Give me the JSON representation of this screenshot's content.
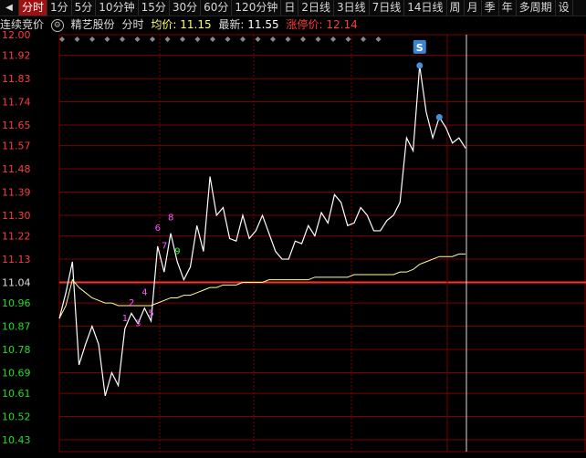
{
  "toolbar": {
    "tabs": [
      {
        "label": "分时",
        "active": true
      },
      {
        "label": "1分"
      },
      {
        "label": "5分"
      },
      {
        "label": "10分钟"
      },
      {
        "label": "15分"
      },
      {
        "label": "30分"
      },
      {
        "label": "60分"
      },
      {
        "label": "120分钟"
      },
      {
        "label": "日"
      },
      {
        "label": "2日线"
      },
      {
        "label": "3日线"
      },
      {
        "label": "7日线"
      },
      {
        "label": "14日线"
      },
      {
        "label": "周"
      },
      {
        "label": "月"
      },
      {
        "label": "季"
      },
      {
        "label": "年"
      },
      {
        "label": "多周期"
      },
      {
        "label": "设"
      }
    ]
  },
  "info": {
    "auction": "连续竞价",
    "stock_name": "精艺股份",
    "mode": "分时",
    "avg_label": "均价:",
    "avg_value": "11.15",
    "latest_label": "最新:",
    "latest_value": "11.55",
    "limit_label": "涨停价:",
    "limit_value": "12.14"
  },
  "marker_s": "S",
  "colors": {
    "up": "#ff3b3b",
    "down": "#22dd22",
    "ref": "#ff3030",
    "price": "#ffffff",
    "avg": "#ffff99",
    "grid": "#7a0000",
    "pink": "#ff55ff"
  },
  "chart_data": {
    "type": "line",
    "y_ticks": [
      "12.00",
      "11.92",
      "11.83",
      "11.74",
      "11.65",
      "11.57",
      "11.48",
      "11.39",
      "11.30",
      "11.22",
      "11.13",
      "11.04",
      "10.96",
      "10.87",
      "10.78",
      "10.69",
      "10.61",
      "10.52",
      "10.43"
    ],
    "ylim": [
      10.43,
      12.0
    ],
    "prev_close": 11.04,
    "price_series": [
      10.9,
      11.0,
      11.12,
      10.72,
      10.8,
      10.87,
      10.8,
      10.6,
      10.69,
      10.64,
      10.86,
      10.92,
      10.88,
      10.94,
      10.89,
      11.18,
      11.08,
      11.23,
      11.12,
      11.05,
      11.1,
      11.26,
      11.16,
      11.45,
      11.3,
      11.33,
      11.21,
      11.2,
      11.3,
      11.21,
      11.24,
      11.3,
      11.23,
      11.16,
      11.13,
      11.13,
      11.2,
      11.19,
      11.26,
      11.22,
      11.31,
      11.27,
      11.38,
      11.35,
      11.26,
      11.27,
      11.33,
      11.3,
      11.24,
      11.24,
      11.28,
      11.3,
      11.35,
      11.6,
      11.55,
      11.88,
      11.7,
      11.6,
      11.68,
      11.64,
      11.58,
      11.6,
      11.56
    ],
    "avg_series": [
      10.9,
      10.95,
      11.05,
      11.02,
      11.0,
      10.98,
      10.97,
      10.96,
      10.96,
      10.95,
      10.95,
      10.95,
      10.95,
      10.95,
      10.95,
      10.96,
      10.97,
      10.98,
      10.98,
      10.99,
      10.99,
      11.0,
      11.01,
      11.02,
      11.02,
      11.03,
      11.03,
      11.03,
      11.04,
      11.04,
      11.04,
      11.04,
      11.05,
      11.05,
      11.05,
      11.05,
      11.05,
      11.05,
      11.05,
      11.06,
      11.06,
      11.06,
      11.06,
      11.06,
      11.06,
      11.07,
      11.07,
      11.07,
      11.07,
      11.07,
      11.07,
      11.07,
      11.08,
      11.08,
      11.09,
      11.11,
      11.12,
      11.13,
      11.14,
      11.14,
      11.14,
      11.15,
      11.15
    ],
    "labels": [
      {
        "text": "1",
        "i": 10,
        "v": 10.89
      },
      {
        "text": "2",
        "i": 11,
        "v": 10.95
      },
      {
        "text": "3",
        "i": 12,
        "v": 10.87
      },
      {
        "text": "4",
        "i": 13,
        "v": 10.99
      },
      {
        "text": "5",
        "i": 14,
        "v": 10.91
      },
      {
        "text": "6",
        "i": 15,
        "v": 11.24
      },
      {
        "text": "7",
        "i": 16,
        "v": 11.17
      },
      {
        "text": "8",
        "i": 17,
        "v": 11.28
      },
      {
        "text": "9",
        "i": 18,
        "v": 11.15
      }
    ],
    "dots": [
      {
        "i": 55,
        "v": 11.88
      },
      {
        "i": 58,
        "v": 11.68
      }
    ]
  }
}
